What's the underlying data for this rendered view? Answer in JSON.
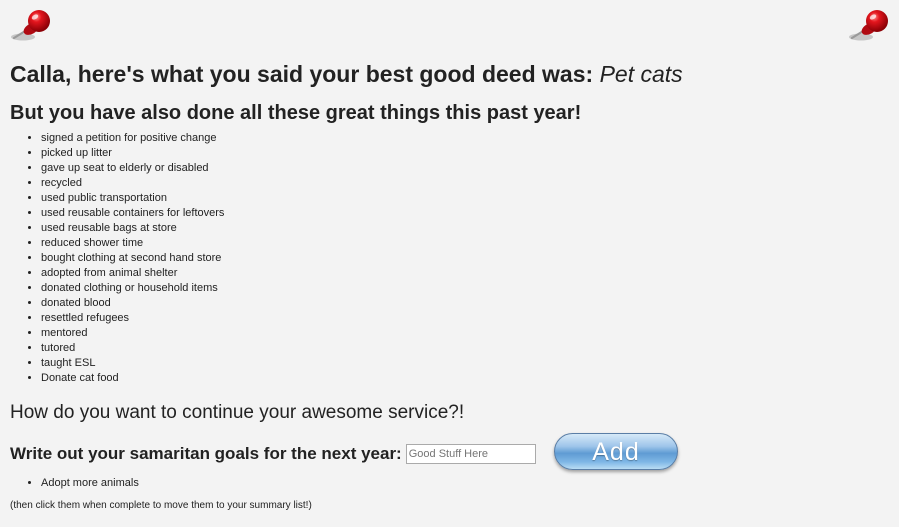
{
  "header": {
    "title_prefix": "Calla, here's what you said your best good deed was:",
    "best_deed": "Pet cats",
    "subtitle": "But you have also done all these great things this past year!"
  },
  "deeds": [
    "signed a petition for positive change",
    "picked up litter",
    "gave up seat to elderly or disabled",
    "recycled",
    "used public transportation",
    "used reusable containers for leftovers",
    "used reusable bags at store",
    "reduced shower time",
    "bought clothing at second hand store",
    "adopted from animal shelter",
    "donated clothing or household items",
    "donated blood",
    "resettled refugees",
    "mentored",
    "tutored",
    "taught ESL",
    "Donate cat food"
  ],
  "continue_heading": "How do you want to continue your awesome service?!",
  "goals_form": {
    "label": "Write out your samaritan goals for the next year:",
    "input_value": "",
    "input_placeholder": "Good Stuff Here",
    "add_label": "Add"
  },
  "goals": [
    "Adopt more animals"
  ],
  "hint": "(then click them when complete to move them to your summary list!)",
  "colors": {
    "pin": "#d0121b",
    "button_blue": "#5f9bd3"
  },
  "icons": [
    "pushpin-icon",
    "pushpin-icon"
  ]
}
